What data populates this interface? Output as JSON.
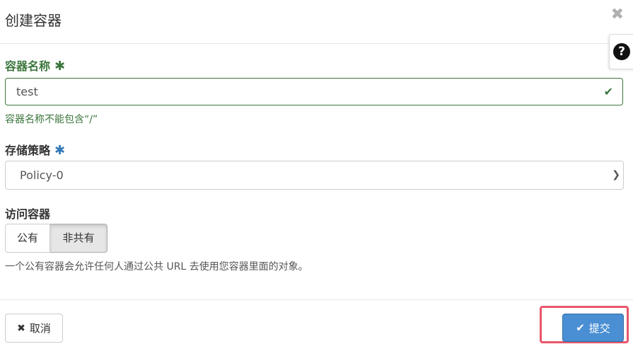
{
  "dialog": {
    "title": "创建容器",
    "close_glyph": "✖",
    "help_glyph": "?"
  },
  "form": {
    "name": {
      "label": "容器名称",
      "required_mark": "✱",
      "value": "test",
      "valid_icon": "check-icon",
      "help_text": "容器名称不能包含“/”"
    },
    "policy": {
      "label": "存储策略",
      "required_mark": "✱",
      "selected": "Policy-0"
    },
    "access": {
      "label": "访问容器",
      "options": [
        "公有",
        "非共有"
      ],
      "selected": "非共有",
      "help_text": "一个公有容器会允许任何人通过公共 URL 去使用您容器里面的对象。"
    }
  },
  "footer": {
    "cancel_label": "取消",
    "submit_label": "提交"
  },
  "colors": {
    "success": "#3c763d",
    "primary": "#4a8fd3",
    "required_blue": "#337ab7",
    "highlight": "#e8576a"
  }
}
